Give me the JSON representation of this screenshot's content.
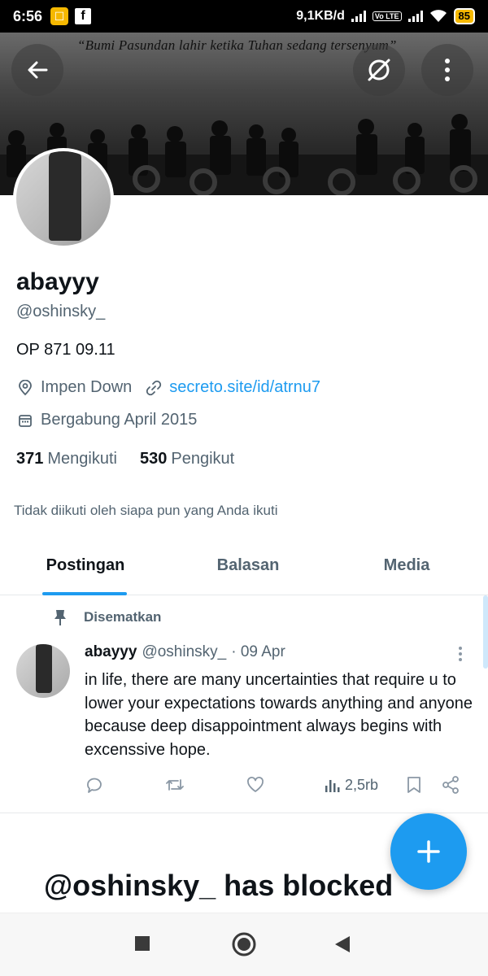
{
  "status_bar": {
    "time": "6:56",
    "network_speed": "9,1KB/d",
    "volte": "Vo LTE",
    "battery": "85"
  },
  "header": {
    "banner_quote": "“Bumi Pasundan lahir ketika Tuhan sedang tersenyum”",
    "back_icon": "arrow-left-icon",
    "mute_icon": "mute-icon",
    "more_icon": "more-vertical-icon"
  },
  "profile": {
    "name": "abayyy",
    "handle": "@oshinsky_",
    "bio": "OP 871 09.11",
    "location": "Impen Down",
    "website": "secreto.site/id/atrnu7",
    "joined": "Bergabung April 2015",
    "following_count": "371",
    "following_label": "Mengikuti",
    "followers_count": "530",
    "followers_label": "Pengikut",
    "not_followed_text": "Tidak diikuti oleh siapa pun yang Anda ikuti"
  },
  "tabs": [
    {
      "label": "Postingan",
      "active": true
    },
    {
      "label": "Balasan",
      "active": false
    },
    {
      "label": "Media",
      "active": false
    }
  ],
  "pinned_tweet": {
    "pinned_label": "Disematkan",
    "author_name": "abayyy",
    "author_handle": "@oshinsky_",
    "date": "· 09 Apr",
    "text": "in life, there are many uncertainties that require u to lower your expectations towards anything and anyone because deep disappointment always begins with excenssive hope.",
    "views": "2,5rb"
  },
  "blocked_text": "@oshinsky_ has blocked",
  "colors": {
    "accent": "#1d9bf0",
    "secondary_text": "#536471",
    "primary_text": "#0f1419"
  }
}
